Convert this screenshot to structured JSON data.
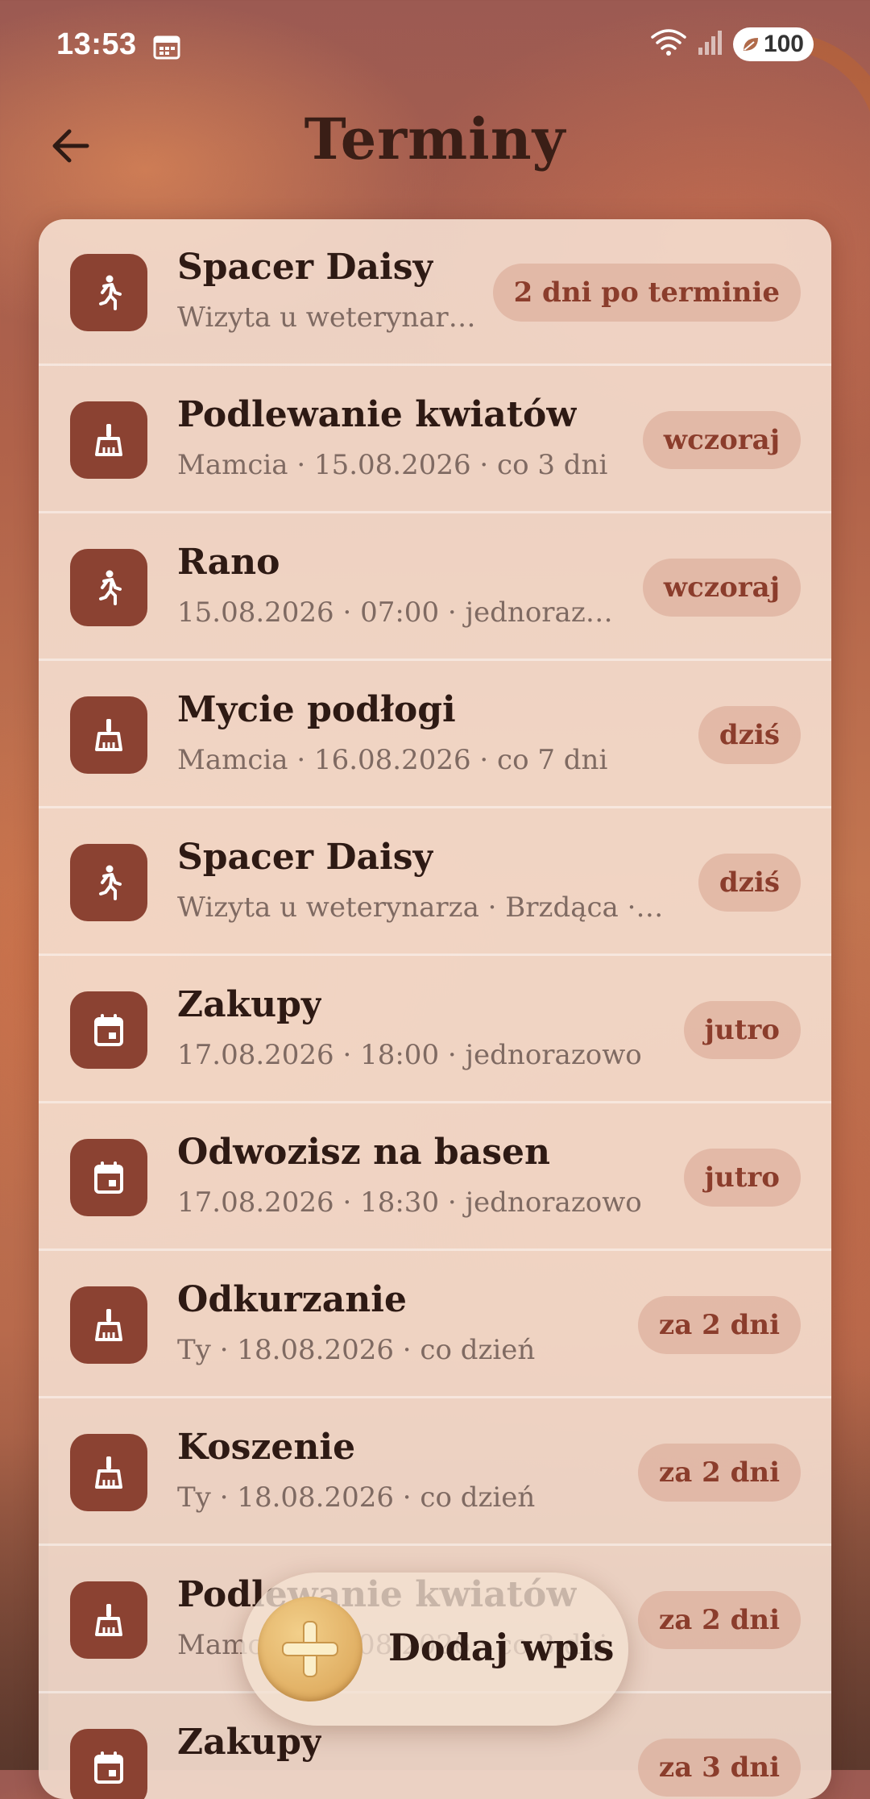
{
  "status_bar": {
    "time": "13:53",
    "battery": "100"
  },
  "header": {
    "title": "Terminy",
    "back_icon": "arrow-left-icon"
  },
  "colors": {
    "accent": "#8b4232",
    "badge_text": "#8b3d2c",
    "fab": "#e0ae62"
  },
  "items": [
    {
      "icon": "walk-icon",
      "title": "Spacer Daisy",
      "subtitle": "Wizyta u weterynar…",
      "badge": "2 dni po terminie"
    },
    {
      "icon": "broom-icon",
      "title": "Podlewanie kwiatów",
      "subtitle": "Mamcia · 15.08.2026 · co 3 dni",
      "badge": "wczoraj"
    },
    {
      "icon": "walk-icon",
      "title": "Rano",
      "subtitle": "15.08.2026 · 07:00 · jednorazo…",
      "badge": "wczoraj"
    },
    {
      "icon": "broom-icon",
      "title": "Mycie podłogi",
      "subtitle": "Mamcia · 16.08.2026 · co 7 dni",
      "badge": "dziś"
    },
    {
      "icon": "walk-icon",
      "title": "Spacer Daisy",
      "subtitle": "Wizyta u weterynarza · Brzdąca ·…",
      "badge": "dziś"
    },
    {
      "icon": "calendar-icon",
      "title": "Zakupy",
      "subtitle": "17.08.2026 · 18:00 · jednorazowo",
      "badge": "jutro"
    },
    {
      "icon": "calendar-icon",
      "title": "Odwozisz na basen",
      "subtitle": "17.08.2026 · 18:30 · jednorazowo",
      "badge": "jutro"
    },
    {
      "icon": "broom-icon",
      "title": "Odkurzanie",
      "subtitle": "Ty · 18.08.2026 · co dzień",
      "badge": "za 2 dni"
    },
    {
      "icon": "broom-icon",
      "title": "Koszenie",
      "subtitle": "Ty · 18.08.2026 · co dzień",
      "badge": "za 2 dni"
    },
    {
      "icon": "broom-icon",
      "title": "Podlewanie kwiatów",
      "subtitle": "Mamcia · 18.08.2026 · co 3 dni",
      "badge": "za 2 dni"
    },
    {
      "icon": "calendar-icon",
      "title": "Zakupy",
      "subtitle": "",
      "badge": "za 3 dni"
    }
  ],
  "fab": {
    "label": "Dodaj wpis",
    "icon": "plus-icon"
  }
}
